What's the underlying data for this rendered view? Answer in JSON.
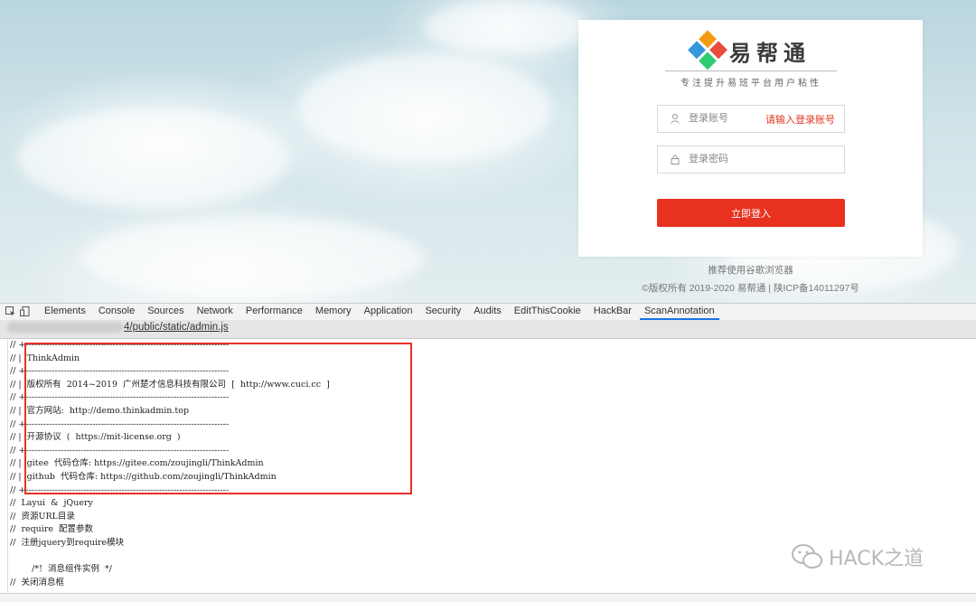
{
  "login": {
    "brand_name": "易帮通",
    "slogan": "专注提升易班平台用户粘性",
    "account_placeholder": "登录账号",
    "account_error": "请输入登录账号",
    "password_placeholder": "登录密码",
    "login_button": "立即登入",
    "footer_hint": "推荐使用谷歌浏览器",
    "copyright": "©版权所有 2019-2020 易帮通 | 陕ICP备14011297号"
  },
  "devtools": {
    "tabs": [
      "Elements",
      "Console",
      "Sources",
      "Network",
      "Performance",
      "Memory",
      "Application",
      "Security",
      "Audits",
      "EditThisCookie",
      "HackBar",
      "ScanAnnotation"
    ],
    "active_tab": "ScanAnnotation",
    "source_file": "4/public/static/admin.js",
    "code_lines": [
      "// +----------------------------------------------------------------------",
      "// |  ThinkAdmin",
      "// +----------------------------------------------------------------------",
      "// |  版权所有  2014~2019  广州楚才信息科技有限公司  [  http://www.cuci.cc  ]",
      "// +----------------------------------------------------------------------",
      "// |  官方网站:  http://demo.thinkadmin.top",
      "// +----------------------------------------------------------------------",
      "// |  开源协议  (  https://mit-license.org  )",
      "// +----------------------------------------------------------------------",
      "// |  gitee  代码仓库: https://gitee.com/zoujingli/ThinkAdmin",
      "// |  github  代码仓库: https://github.com/zoujingli/ThinkAdmin",
      "// +----------------------------------------------------------------------",
      "//  Layui  &  jQuery",
      "//  资源URL目录",
      "//  require  配置参数",
      "//  注册jquery到require模块",
      "",
      "        /*!  消息组件实例  */",
      "//  关闭消息框"
    ]
  },
  "watermark": {
    "text": "HACK之道"
  },
  "colors": {
    "accent_red": "#e8311e",
    "active_tab": "#1a73e8",
    "highlight_box": "#e5312b"
  }
}
